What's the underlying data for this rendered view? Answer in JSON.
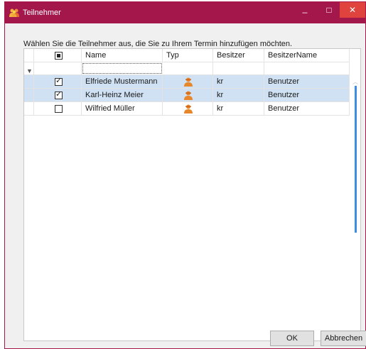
{
  "window": {
    "title": "Teilnehmer",
    "minimize_glyph": "_",
    "maximize_glyph": "□",
    "close_glyph": "✕"
  },
  "instruction": "Wählen Sie die Teilnehmer aus, die Sie zu Ihrem Termin hinzufügen möchten.",
  "grid": {
    "columns": [
      "Name",
      "Typ",
      "Besitzer",
      "BesitzerName"
    ],
    "header_checkbox_state": "indeterminate",
    "filter_icon": "filter-icon",
    "rows": [
      {
        "checked": true,
        "name": "Elfriede Mustermann",
        "type_icon": "person-icon",
        "owner": "kr",
        "owner_name": "Benutzer",
        "selected": true
      },
      {
        "checked": true,
        "name": "Karl-Heinz Meier",
        "type_icon": "person-icon",
        "owner": "kr",
        "owner_name": "Benutzer",
        "selected": true
      },
      {
        "checked": false,
        "name": "Wilfried Müller",
        "type_icon": "person-icon",
        "owner": "kr",
        "owner_name": "Benutzer",
        "selected": false
      }
    ]
  },
  "buttons": {
    "ok": "OK",
    "cancel": "Abbrechen"
  },
  "colors": {
    "titlebar": "#a3174b",
    "close_button": "#e0433e",
    "selection": "#cfe1f3",
    "scroll_thumb": "#3a8ee6",
    "person_icon": "#e8862a"
  }
}
